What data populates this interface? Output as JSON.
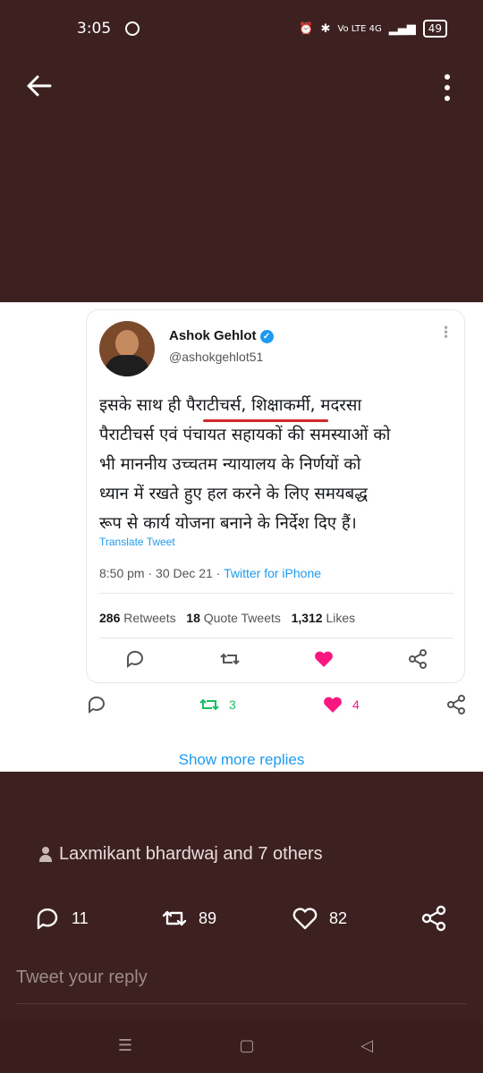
{
  "status_bar": {
    "time": "3:05",
    "battery": "49",
    "network": "Vo LTE 4G"
  },
  "tweet": {
    "author_name": "Ashok Gehlot",
    "handle": "@ashokgehlot51",
    "text_lines": [
      "इसके साथ ही पैराटीचर्स, शिक्षाकर्मी, मदरसा",
      "पैराटीचर्स एवं पंचायत सहायकों की समस्याओं को",
      "भी माननीय उच्चतम न्यायालय के निर्णयों को",
      "ध्यान में रखते हुए हल करने के लिए समयबद्ध",
      "रूप से कार्य योजना बनाने के निर्देश दिए हैं।"
    ],
    "translate": "Translate Tweet",
    "time": "8:50 pm",
    "date": "30 Dec 21",
    "source": "Twitter for iPhone",
    "retweets": "286",
    "retweets_label": "Retweets",
    "quotes": "18",
    "quotes_label": "Quote Tweets",
    "likes": "1,312",
    "likes_label": "Likes"
  },
  "image_actions": {
    "retweets": "3",
    "likes": "4"
  },
  "show_more": "Show more replies",
  "liked_by": "Laxmikant bhardwaj and 7 others",
  "post_actions": {
    "replies": "11",
    "retweets": "89",
    "likes": "82"
  },
  "reply_placeholder": "Tweet your reply",
  "colors": {
    "accent": "#1d9bf0",
    "like": "#f91880",
    "retweet": "#17bf63",
    "background": "#3d2020"
  }
}
